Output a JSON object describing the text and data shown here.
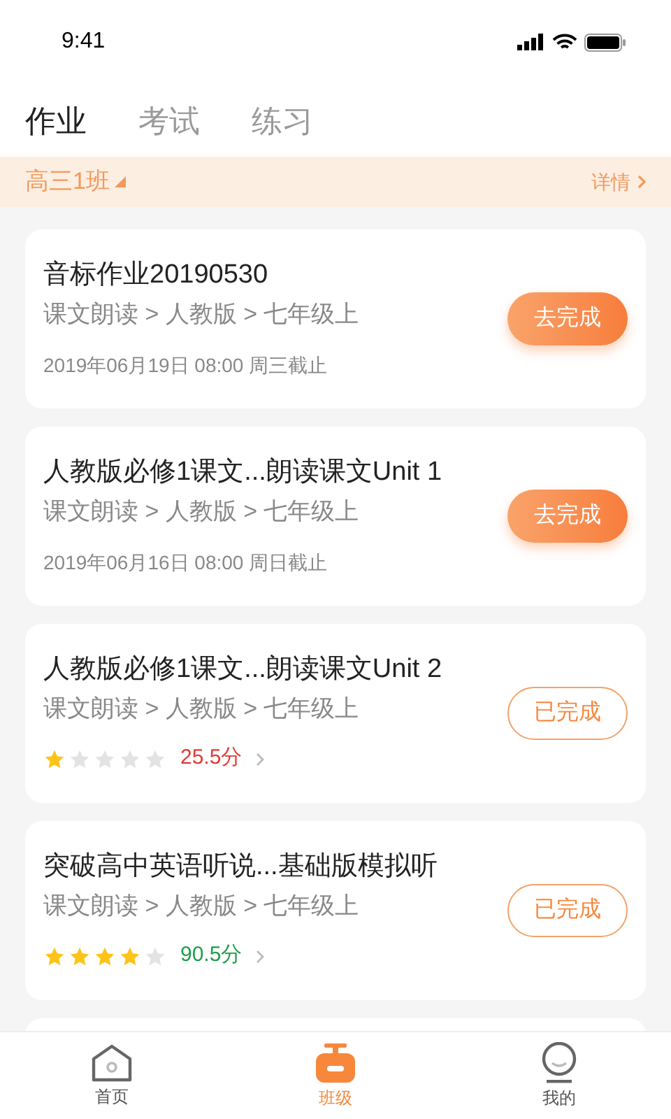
{
  "status_bar": {
    "time": "9:41"
  },
  "tabs": [
    {
      "label": "作业",
      "selected": true
    },
    {
      "label": "考试",
      "selected": false
    },
    {
      "label": "练习",
      "selected": false
    }
  ],
  "class_bar": {
    "class_name": "高三1班",
    "details": "详情"
  },
  "assignments": [
    {
      "kind": "pending",
      "title": "音标作业20190530",
      "path": "课文朗读 > 人教版 > 七年级上",
      "deadline": "2019年06月19日 08:00 周三截止",
      "action": "去完成"
    },
    {
      "kind": "pending",
      "title": "人教版必修1课文...朗读课文Unit 1",
      "path": "课文朗读 > 人教版 > 七年级上",
      "deadline": "2019年06月16日 08:00 周日截止",
      "action": "去完成"
    },
    {
      "kind": "done",
      "title": "人教版必修1课文...朗读课文Unit 2",
      "path": "课文朗读 > 人教版 > 七年级上",
      "stars": 1,
      "score": "25.5分",
      "color": "#e53935",
      "action": "已完成"
    },
    {
      "kind": "done",
      "title": "突破高中英语听说...基础版模拟听",
      "path": "课文朗读 > 人教版 > 七年级上",
      "stars": 4,
      "score": "90.5分",
      "color": "#1e9e4a",
      "action": "已完成"
    }
  ],
  "bottom_nav": [
    {
      "label": "首页",
      "selected": false
    },
    {
      "label": "班级",
      "selected": true
    },
    {
      "label": "我的",
      "selected": false
    }
  ]
}
